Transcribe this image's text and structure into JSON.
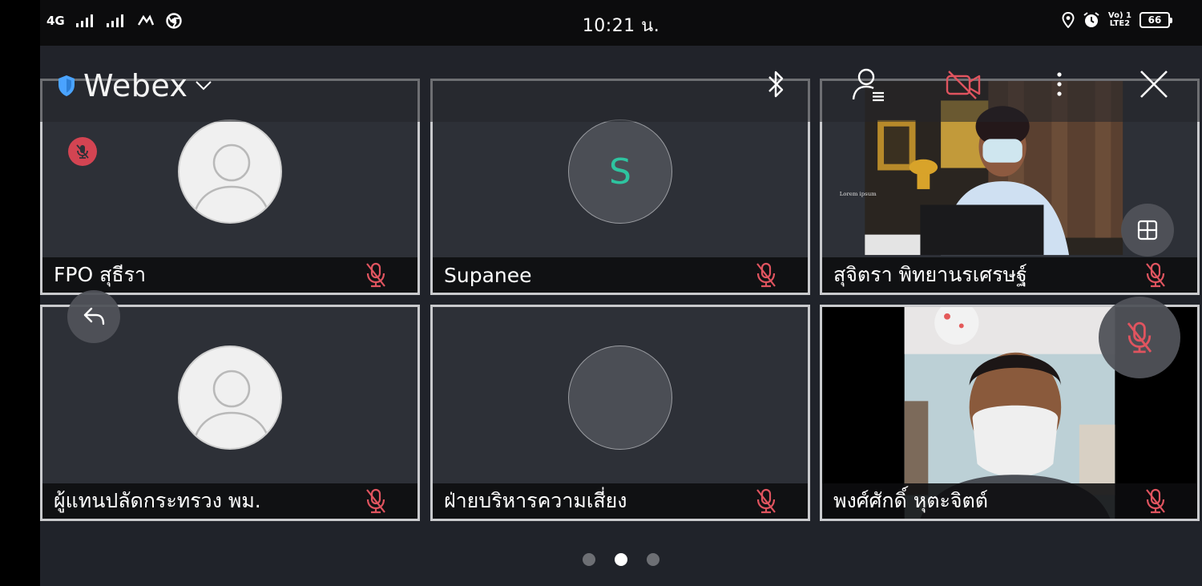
{
  "status_bar": {
    "network_left": "4G",
    "time": "10:21 น.",
    "volte_top": "Vo) 1",
    "volte_bottom": "LTE2",
    "battery": "66"
  },
  "toolbar": {
    "app_title": "Webex",
    "icons": [
      "shield-icon",
      "chevron-down-icon",
      "bluetooth-icon",
      "participants-icon",
      "video-off-icon",
      "more-icon",
      "close-icon"
    ]
  },
  "tiles": [
    {
      "name": "FPO สุธีรา",
      "avatar": "default",
      "muted": true
    },
    {
      "name": "Supanee",
      "avatar": "letter",
      "initial": "S",
      "muted": true
    },
    {
      "name": "สุจิตรา พิทยานรเศรษฐ์",
      "avatar": "video",
      "muted": true,
      "video_caption": "Lorem ipsum"
    },
    {
      "name": "ผู้แทนปลัดกระทรวง พม.",
      "avatar": "default",
      "muted": true
    },
    {
      "name": "ฝ่ายบริหารความเสี่ยง",
      "avatar": "blank",
      "muted": true
    },
    {
      "name": "พงศ์ศักดิ์ หุตะจิตต์",
      "avatar": "video",
      "muted": true
    }
  ],
  "pagination": {
    "total": 3,
    "current": 2
  },
  "colors": {
    "background": "#20232a",
    "tile": "#2d3037",
    "mute_red": "#e0545f",
    "accent_teal": "#2ec4a0",
    "shield_blue": "#4aa3ff"
  }
}
